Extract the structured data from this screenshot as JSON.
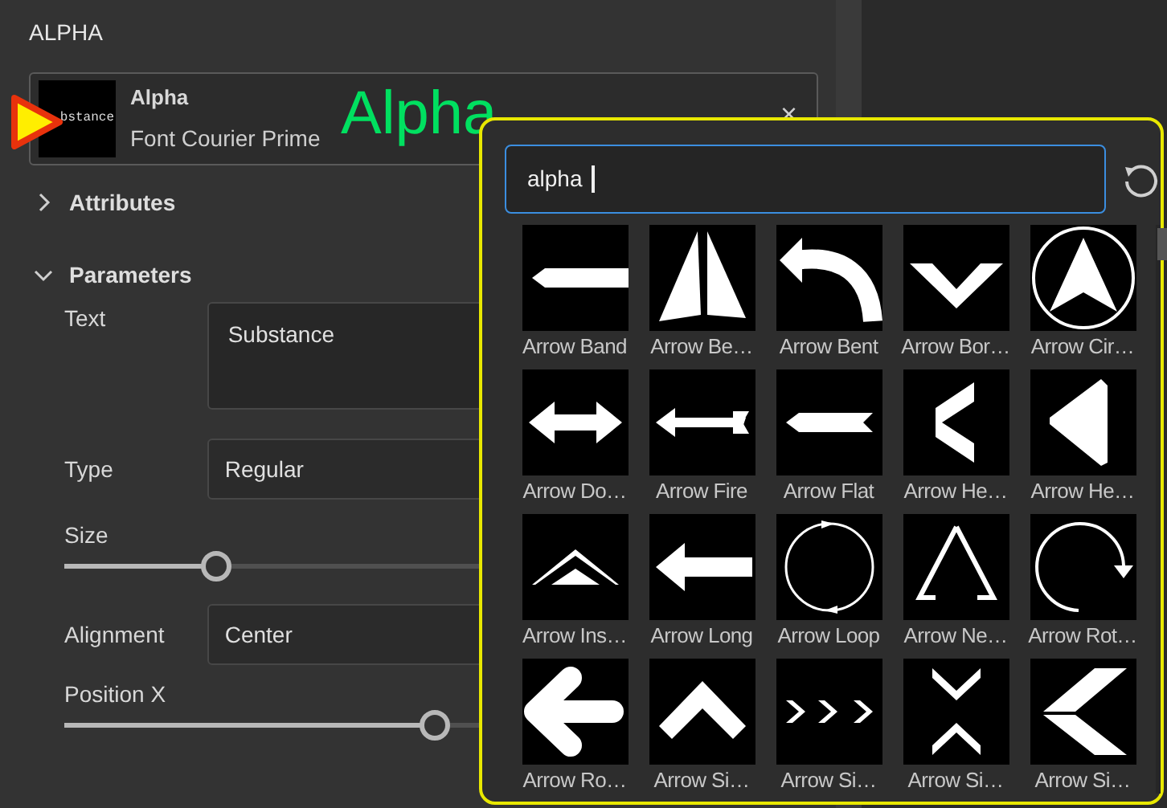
{
  "panel": {
    "title": "ALPHA",
    "card": {
      "name": "Alpha",
      "subtitle": "Font Courier Prime",
      "thumbnail_text": "bstance",
      "close": "×"
    },
    "annotation": "Alpha",
    "sections": [
      {
        "label": "Attributes",
        "expanded": false
      },
      {
        "label": "Parameters",
        "expanded": true
      }
    ],
    "params": [
      {
        "kind": "textarea",
        "label": "Text",
        "value": "Substance"
      },
      {
        "kind": "select",
        "label": "Type",
        "value": "Regular"
      },
      {
        "kind": "slider",
        "label": "Size",
        "level": 0.2
      },
      {
        "kind": "select",
        "label": "Alignment",
        "value": "Center"
      },
      {
        "kind": "slider",
        "label": "Position X",
        "level": 0.49
      }
    ]
  },
  "picker": {
    "search": {
      "value": "alpha"
    },
    "items": [
      {
        "label": "Arrow Band"
      },
      {
        "label": "Arrow Be…"
      },
      {
        "label": "Arrow Bent"
      },
      {
        "label": "Arrow Bor…"
      },
      {
        "label": "Arrow Cir…"
      },
      {
        "label": "Arrow Do…"
      },
      {
        "label": "Arrow Fire"
      },
      {
        "label": "Arrow Flat"
      },
      {
        "label": "Arrow He…"
      },
      {
        "label": "Arrow He…"
      },
      {
        "label": "Arrow Ins…"
      },
      {
        "label": "Arrow Long"
      },
      {
        "label": "Arrow Loop"
      },
      {
        "label": "Arrow Ne…"
      },
      {
        "label": "Arrow Rot…"
      },
      {
        "label": "Arrow Ro…"
      },
      {
        "label": "Arrow Si…"
      },
      {
        "label": "Arrow Si…"
      },
      {
        "label": "Arrow Si…"
      },
      {
        "label": "Arrow Si…"
      }
    ]
  }
}
